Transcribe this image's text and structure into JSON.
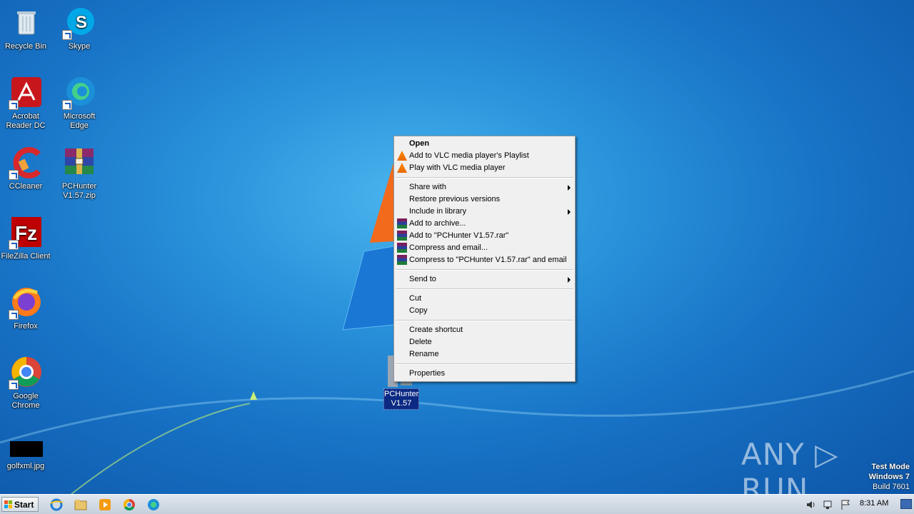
{
  "desktop_icons": [
    {
      "name": "recycle-bin-icon",
      "label": "Recycle Bin"
    },
    {
      "name": "skype-icon",
      "label": "Skype"
    },
    {
      "name": "acrobat-icon",
      "label": "Acrobat Reader DC"
    },
    {
      "name": "edge-icon",
      "label": "Microsoft Edge"
    },
    {
      "name": "ccleaner-icon",
      "label": "CCleaner"
    },
    {
      "name": "winrar-archive-icon",
      "label": "PCHunter V1.57.zip"
    },
    {
      "name": "filezilla-icon",
      "label": "FileZilla Client"
    },
    {
      "name": "firefox-icon",
      "label": "Firefox"
    },
    {
      "name": "chrome-icon",
      "label": "Google Chrome"
    },
    {
      "name": "image-file-icon",
      "label": "golfxml.jpg"
    }
  ],
  "selected_item": {
    "label": "PCHunter V1.57"
  },
  "context_menu": {
    "open": "Open",
    "vlc_add": "Add to VLC media player's Playlist",
    "vlc_play": "Play with VLC media player",
    "share_with": "Share with",
    "restore": "Restore previous versions",
    "include_library": "Include in library",
    "add_archive": "Add to archive...",
    "add_rar": "Add to \"PCHunter V1.57.rar\"",
    "compress_email": "Compress and email...",
    "compress_rar_email": "Compress to \"PCHunter V1.57.rar\" and email",
    "send_to": "Send to",
    "cut": "Cut",
    "copy": "Copy",
    "create_shortcut": "Create shortcut",
    "delete": "Delete",
    "rename": "Rename",
    "properties": "Properties"
  },
  "taskbar": {
    "start_label": "Start",
    "clock": "8:31 AM",
    "pinned": [
      "internet-explorer-icon",
      "explorer-folder-icon",
      "media-player-icon",
      "chrome-icon",
      "edge-icon"
    ]
  },
  "watermark": {
    "line1": "Test Mode",
    "line2": "Windows 7",
    "line3": "Build 7601",
    "brand": "ANY ▷ RUN"
  }
}
